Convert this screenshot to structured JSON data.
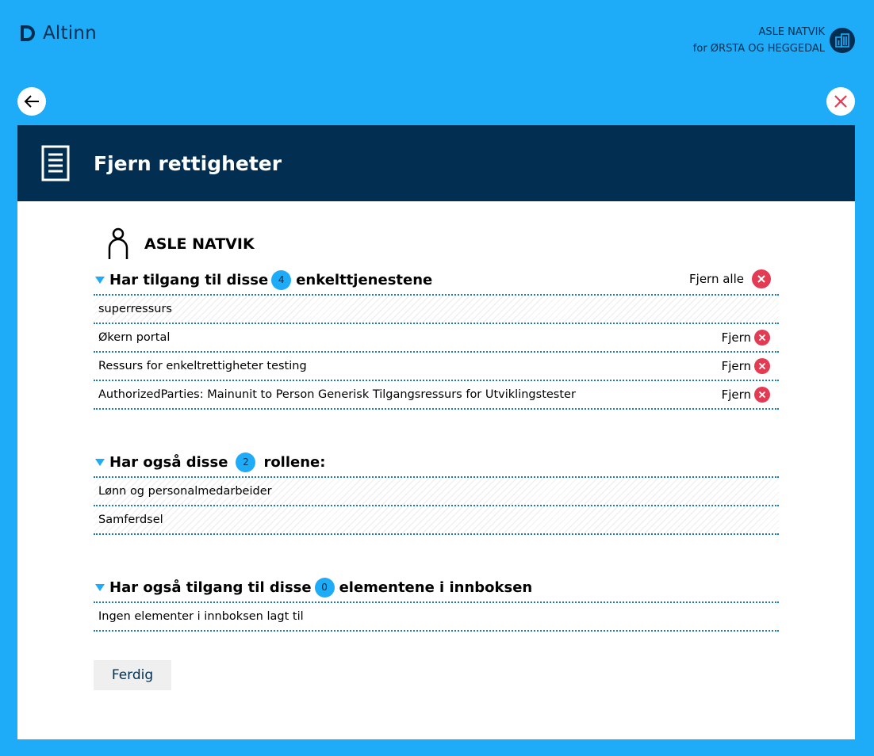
{
  "header": {
    "logo_text": "Altinn",
    "user_name": "ASLE NATVIK",
    "user_org": "for ØRSTA OG HEGGEDAL"
  },
  "panel": {
    "title": "Fjern rettigheter",
    "person_name": "ASLE NATVIK"
  },
  "services": {
    "title_before": "Har tilgang til disse",
    "count": "4",
    "title_after": "enkelttjenestene",
    "remove_all_label": "Fjern alle",
    "items": [
      {
        "label": "superressurs",
        "action": ""
      },
      {
        "label": "Økern portal",
        "action": "Fjern"
      },
      {
        "label": "Ressurs for enkeltrettigheter testing",
        "action": "Fjern"
      },
      {
        "label": "AuthorizedParties: Mainunit to Person Generisk Tilgangsressurs for Utviklingstester",
        "action": "Fjern"
      }
    ]
  },
  "roles": {
    "title_before": "Har også disse",
    "count": "2",
    "title_after": "rollene:",
    "items": [
      {
        "label": "Lønn og personalmedarbeider"
      },
      {
        "label": "Samferdsel"
      }
    ]
  },
  "inbox": {
    "title_before": "Har også tilgang til disse",
    "count": "0",
    "title_after": "elementene i innboksen",
    "items": [
      {
        "label": "Ingen elementer i innboksen lagt til"
      }
    ]
  },
  "finish_label": "Ferdig",
  "colors": {
    "background": "#1eabf7",
    "navy": "#022f51",
    "remove_red": "#e23b53"
  },
  "icons": [
    "altinn-logo-icon",
    "building-icon",
    "arrow-left-icon",
    "close-icon",
    "document-icon",
    "person-icon",
    "remove-icon"
  ]
}
